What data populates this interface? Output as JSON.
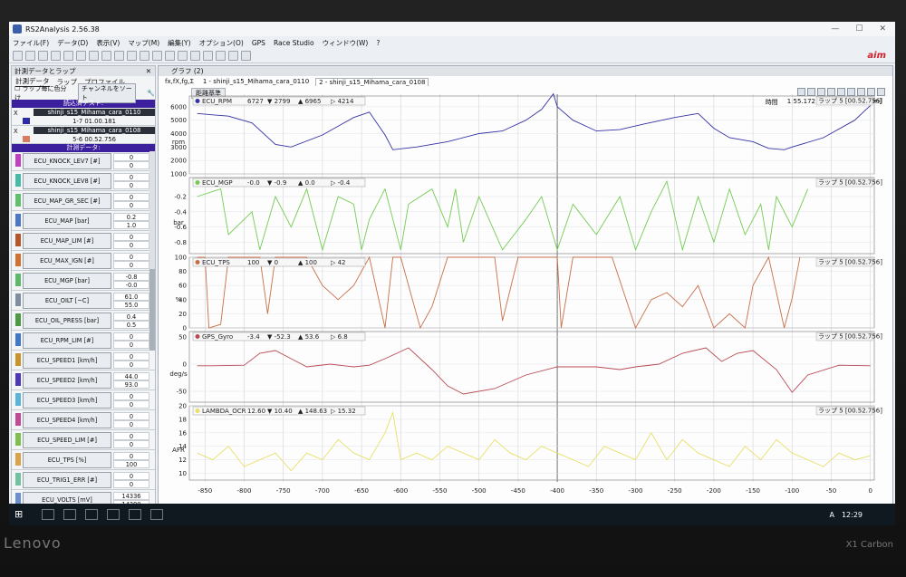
{
  "window": {
    "title": "RS2Analysis 2.56.38",
    "controls": [
      "—",
      "☐",
      "✕"
    ]
  },
  "menu": [
    "ファイル(F)",
    "データ(D)",
    "表示(V)",
    "マップ(M)",
    "編集(Y)",
    "オプション(O)",
    "GPS",
    "Race Studio",
    "ウィンドウ(W)",
    "?"
  ],
  "left_panel": {
    "title": "計測データとラップ",
    "tabs": [
      "計測データ",
      "ラップ",
      "プロファイル"
    ],
    "lap_color_label": "ラップ毎に色分け",
    "channel_sort_label": "チャンネルをソート",
    "sessions_header": "読込済テスト:",
    "sessions": [
      {
        "x": "X",
        "name": "shinji_s15_Mihama_cara_0110",
        "lap": "1-7 01.00.181",
        "color": "#2d2aa8"
      },
      {
        "x": "X",
        "name": "shinji_s15_Mihama_cara_0108",
        "lap": "5-6 00.52.756",
        "color": "#d97b5e"
      }
    ],
    "channels_header": "計測データ:",
    "channels": [
      {
        "name": "ECU_KNOCK_LEV7",
        "unit": "[#]",
        "v1": "0",
        "v2": "0",
        "color": "#c23fbf"
      },
      {
        "name": "ECU_KNOCK_LEV8",
        "unit": "[#]",
        "v1": "0",
        "v2": "0",
        "color": "#47b9a7"
      },
      {
        "name": "ECU_MAP_GR_SEC",
        "unit": "[#]",
        "v1": "0",
        "v2": "0",
        "color": "#5fbf6a"
      },
      {
        "name": "ECU_MAP",
        "unit": "[bar]",
        "v1": "0.2",
        "v2": "1.0",
        "color": "#4a78c7"
      },
      {
        "name": "ECU_MAP_LIM",
        "unit": "[#]",
        "v1": "0",
        "v2": "0",
        "color": "#b5562b"
      },
      {
        "name": "ECU_MAX_IGN",
        "unit": "[#]",
        "v1": "0",
        "v2": "0",
        "color": "#d0712f"
      },
      {
        "name": "ECU_MGP",
        "unit": "[bar]",
        "v1": "-0.8",
        "v2": "-0.0",
        "color": "#5eb86a"
      },
      {
        "name": "ECU_OILT",
        "unit": "[~C]",
        "v1": "61.0",
        "v2": "55.0",
        "color": "#7f8fa0"
      },
      {
        "name": "ECU_OIL_PRESS",
        "unit": "[bar]",
        "v1": "0.4",
        "v2": "0.5",
        "color": "#4d9a45"
      },
      {
        "name": "ECU_RPM_LIM",
        "unit": "[#]",
        "v1": "0",
        "v2": "0",
        "color": "#3f78c8"
      },
      {
        "name": "ECU_SPEED1",
        "unit": "[km/h]",
        "v1": "0",
        "v2": "0",
        "color": "#c9932a"
      },
      {
        "name": "ECU_SPEED2",
        "unit": "[km/h]",
        "v1": "44.0",
        "v2": "93.0",
        "color": "#4f37b8"
      },
      {
        "name": "ECU_SPEED3",
        "unit": "[km/h]",
        "v1": "0",
        "v2": "0",
        "color": "#5bb3d6"
      },
      {
        "name": "ECU_SPEED4",
        "unit": "[km/h]",
        "v1": "0",
        "v2": "0",
        "color": "#c14a94"
      },
      {
        "name": "ECU_SPEED_LIM",
        "unit": "[#]",
        "v1": "0",
        "v2": "0",
        "color": "#7fbf4d"
      },
      {
        "name": "ECU_TPS",
        "unit": "[%]",
        "v1": "0",
        "v2": "100",
        "color": "#d9a34a"
      },
      {
        "name": "ECU_TRIG1_ERR",
        "unit": "[#]",
        "v1": "0",
        "v2": "0",
        "color": "#72c2a0"
      },
      {
        "name": "ECU_VOLTS",
        "unit": "[mV]",
        "v1": "14336",
        "v2": "14290",
        "color": "#6a8fd1"
      }
    ]
  },
  "graph": {
    "title": "グラフ (2)",
    "tabs": [
      "fx,fX,fg,Σ",
      "1 - shinji_s15_Mihama_cara_0110",
      "2 - shinji_s15_Mihama_cara_0108"
    ],
    "reference_label": "距離基準",
    "time_label": "時間",
    "time_value": "1:55.172",
    "distance_label": "距離",
    "distance_value": "1805.9 [m]",
    "brand": "aim",
    "lap_tag": "ラップ 5 [00.52.756]",
    "x_axis_ticks": [
      "-850",
      "-800",
      "-750",
      "-700",
      "-650",
      "-600",
      "-550",
      "-500",
      "-450",
      "-400",
      "-350",
      "-300",
      "-250",
      "-200",
      "-150",
      "-100",
      "-50",
      "0"
    ]
  },
  "chart_data": [
    {
      "type": "line",
      "series": [
        {
          "name": "ECU_RPM",
          "color": "#3433a3",
          "x": [
            -860,
            -840,
            -820,
            -790,
            -760,
            -740,
            -700,
            -660,
            -640,
            -620,
            -610,
            -580,
            -540,
            -500,
            -470,
            -440,
            -420,
            -405,
            -400,
            -380,
            -350,
            -320,
            -290,
            -250,
            -220,
            -200,
            -180,
            -150,
            -130,
            -110,
            -100,
            -60,
            -20,
            0
          ],
          "values": [
            5500,
            5400,
            5300,
            4800,
            3200,
            3000,
            3900,
            5200,
            5600,
            3900,
            2800,
            3000,
            3400,
            4000,
            4200,
            5000,
            5800,
            6965,
            6000,
            5000,
            4200,
            4300,
            4700,
            5200,
            5500,
            4400,
            3700,
            3400,
            2900,
            2799,
            3000,
            3700,
            5000,
            6100
          ]
        }
      ],
      "legend_values": {
        "current": "6727",
        "min": "2799",
        "max": "6965",
        "delta": "4214"
      },
      "ylabel": "rpm",
      "y_ticks": [
        "6000",
        "5000",
        "4000",
        "3000",
        "2000",
        "1000"
      ],
      "ylim": [
        1000,
        6800
      ]
    },
    {
      "type": "line",
      "series": [
        {
          "name": "ECU_MGP",
          "color": "#74cc52",
          "x": [
            -860,
            -830,
            -820,
            -790,
            -780,
            -760,
            -740,
            -720,
            -700,
            -680,
            -660,
            -650,
            -640,
            -620,
            -600,
            -590,
            -560,
            -540,
            -530,
            -520,
            -500,
            -470,
            -440,
            -420,
            -400,
            -380,
            -350,
            -320,
            -300,
            -280,
            -260,
            -240,
            -220,
            -200,
            -180,
            -160,
            -140,
            -130,
            -120,
            -100,
            -80
          ],
          "values": [
            -0.2,
            -0.1,
            -0.7,
            -0.4,
            -0.9,
            -0.2,
            -0.6,
            -0.1,
            -0.9,
            -0.2,
            -0.3,
            -0.9,
            -0.5,
            -0.1,
            -0.9,
            -0.3,
            -0.1,
            -0.6,
            -0.1,
            -0.8,
            -0.2,
            -0.9,
            -0.5,
            -0.2,
            -0.9,
            -0.3,
            -0.7,
            -0.2,
            -0.9,
            -0.4,
            -0.0,
            -0.9,
            -0.2,
            -0.8,
            -0.1,
            -0.7,
            -0.3,
            -0.9,
            -0.2,
            -0.6,
            -0.1
          ]
        }
      ],
      "legend_values": {
        "current": "-0.0",
        "min": "-0.9",
        "max": "0.0",
        "delta": "-0.4"
      },
      "ylabel": "bar",
      "y_ticks": [
        "-0.2",
        "-0.4",
        "-0.6",
        "-0.8"
      ],
      "ylim": [
        -0.95,
        0.05
      ]
    },
    {
      "type": "line",
      "series": [
        {
          "name": "ECU_TPS",
          "color": "#c86f47",
          "x": [
            -860,
            -850,
            -845,
            -830,
            -820,
            -780,
            -770,
            -760,
            -720,
            -700,
            -680,
            -660,
            -640,
            -620,
            -610,
            -600,
            -575,
            -560,
            -540,
            -520,
            -480,
            -470,
            -450,
            -400,
            -395,
            -380,
            -360,
            -330,
            -300,
            -280,
            -260,
            -240,
            -220,
            -200,
            -180,
            -160,
            -150,
            -130,
            -110,
            -100,
            -90
          ],
          "values": [
            100,
            100,
            0,
            5,
            100,
            100,
            20,
            100,
            100,
            60,
            40,
            60,
            100,
            0,
            100,
            100,
            0,
            30,
            100,
            100,
            100,
            10,
            100,
            100,
            0,
            100,
            100,
            100,
            0,
            40,
            50,
            30,
            60,
            0,
            20,
            0,
            60,
            100,
            0,
            42,
            100
          ]
        }
      ],
      "legend_values": {
        "current": "100",
        "min": "0",
        "max": "100",
        "delta": "42"
      },
      "ylabel": "%",
      "y_ticks": [
        "100",
        "80",
        "60",
        "40",
        "20",
        "0"
      ],
      "ylim": [
        0,
        100
      ]
    },
    {
      "type": "line",
      "series": [
        {
          "name": "GPS_Gyro",
          "color": "#b84a54",
          "x": [
            -860,
            -840,
            -800,
            -780,
            -760,
            -740,
            -720,
            -690,
            -660,
            -640,
            -620,
            -605,
            -590,
            -560,
            -540,
            -520,
            -480,
            -440,
            -400,
            -350,
            -320,
            -300,
            -270,
            -240,
            -210,
            -190,
            -170,
            -150,
            -120,
            -100,
            -80,
            -40,
            0
          ],
          "values": [
            -3,
            -3,
            -2,
            20,
            25,
            10,
            -5,
            0,
            -5,
            -2,
            10,
            20,
            30,
            -10,
            -40,
            -55,
            -45,
            -20,
            -5,
            -5,
            -10,
            -5,
            0,
            20,
            30,
            5,
            20,
            25,
            -10,
            -52,
            -20,
            -2,
            -3
          ]
        }
      ],
      "legend_values": {
        "current": "-3.4",
        "min": "-52.3",
        "max": "53.6",
        "delta": "6.8"
      },
      "ylabel": "deg/s",
      "y_ticks": [
        "50",
        "0",
        "-50"
      ],
      "ylim": [
        -70,
        60
      ]
    },
    {
      "type": "line",
      "series": [
        {
          "name": "LAMBDA_OCR",
          "color": "#e8e06a",
          "x": [
            -860,
            -840,
            -820,
            -800,
            -780,
            -760,
            -740,
            -720,
            -700,
            -680,
            -660,
            -640,
            -620,
            -610,
            -600,
            -580,
            -560,
            -540,
            -520,
            -500,
            -480,
            -460,
            -440,
            -420,
            -400,
            -380,
            -360,
            -340,
            -320,
            -300,
            -280,
            -260,
            -240,
            -220,
            -200,
            -180,
            -160,
            -140,
            -120,
            -100,
            -80,
            -60,
            -40,
            -20,
            0
          ],
          "values": [
            13,
            12,
            14,
            11,
            12,
            13,
            10.4,
            13,
            12,
            15,
            13,
            12,
            16,
            19,
            12,
            13,
            12,
            14,
            13,
            12,
            15,
            13,
            12,
            14,
            13,
            12,
            11,
            14,
            13,
            12,
            16,
            12,
            15,
            13,
            12,
            11,
            14,
            12,
            15,
            13,
            12,
            11,
            13,
            12,
            12.6
          ]
        }
      ],
      "legend_values": {
        "current": "12.60",
        "min": "10.40",
        "max": "148.63",
        "delta": "15.32"
      },
      "ylabel": "AFR",
      "y_ticks": [
        "20",
        "18",
        "16",
        "14",
        "12",
        "10"
      ],
      "ylim": [
        9,
        20
      ]
    }
  ],
  "taskbar": {
    "start": "⊞",
    "time": "12:29",
    "ime": "A"
  },
  "device": {
    "brand": "Lenovo",
    "model": "X1 Carbon"
  }
}
